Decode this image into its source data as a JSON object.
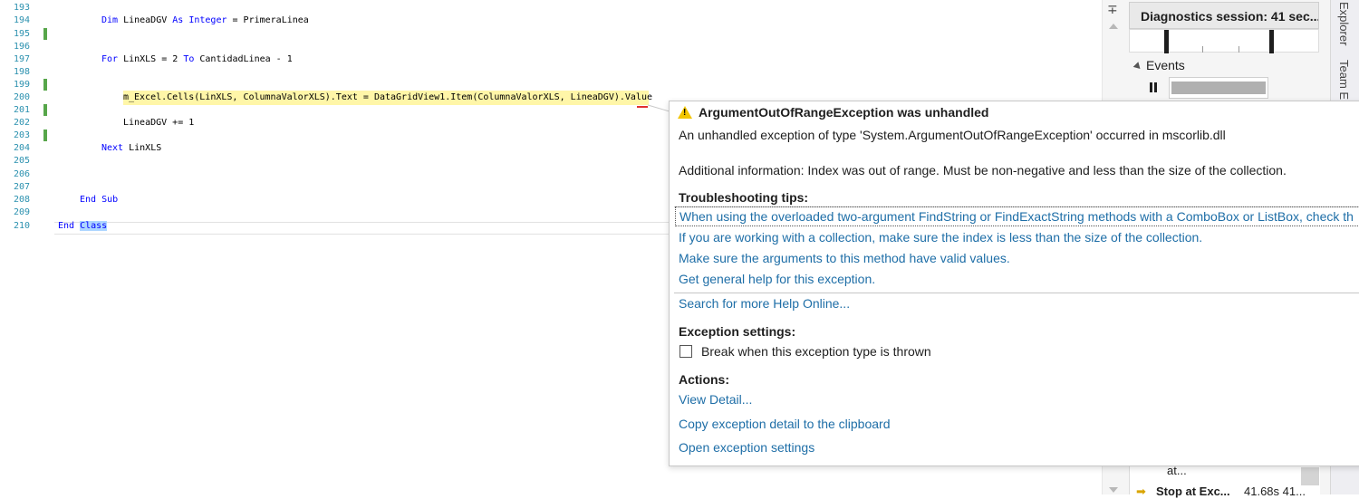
{
  "editor": {
    "line_numbers": [
      "193",
      "194",
      "195",
      "196",
      "197",
      "198",
      "199",
      "200",
      "201",
      "202",
      "203",
      "204",
      "205",
      "206",
      "207",
      "208",
      "209",
      "210"
    ],
    "code": {
      "l194_kw1": "Dim",
      "l194_a": " LineaDGV ",
      "l194_kw2": "As",
      "l194_kw3": " Integer",
      "l194_b": " = PrimeraLinea",
      "l197_kw1": "For",
      "l197_a": " LinXLS = 2 ",
      "l197_kw2": "To",
      "l197_b": " CantidadLinea - 1",
      "l200": "m_Excel.Cells(LinXLS, ColumnaValorXLS).Text = DataGridView1.Item(ColumnaValorXLS, LineaDGV).Value",
      "l202": "LineaDGV += 1",
      "l204_kw": "Next",
      "l204_a": " LinXLS",
      "l208": "End Sub",
      "l210_kw": "End",
      "l210_sel": "Class"
    },
    "colors": {
      "keyword": "#0000ff",
      "line_number": "#2b91af",
      "current_statement": "#fff296",
      "change_marker": "#57a64a"
    }
  },
  "scrollbar": {
    "split_icon": "splitter-icon"
  },
  "diagnostics": {
    "title": "Diagnostics session: 41 sec...",
    "events_label": "Events",
    "event_row_text": "at...",
    "stop_label": "Stop at Exc...",
    "stop_time": "41.68s 41..."
  },
  "side_tabs": {
    "explorer": "Explorer",
    "team": "Team E"
  },
  "exception": {
    "title": "ArgumentOutOfRangeException was unhandled",
    "message": "An unhandled exception of type 'System.ArgumentOutOfRangeException' occurred in mscorlib.dll",
    "additional": "Additional information: Index was out of range. Must be non-negative and less than the size of the collection.",
    "tips_header": "Troubleshooting tips:",
    "tips": [
      "When using the overloaded two-argument FindString or FindExactString methods with a ComboBox or ListBox, check th",
      "If you are working with a collection, make sure the index is less than the size of the collection.",
      "Make sure the arguments to this method have valid values.",
      "Get general help for this exception."
    ],
    "search_online": "Search for more Help Online...",
    "settings_header": "Exception settings:",
    "break_checkbox": "Break when this exception type is thrown",
    "actions_header": "Actions:",
    "actions": [
      "View Detail...",
      "Copy exception detail to the clipboard",
      "Open exception settings"
    ],
    "colors": {
      "link": "#1e6ea7",
      "warning": "#f2c500"
    }
  }
}
